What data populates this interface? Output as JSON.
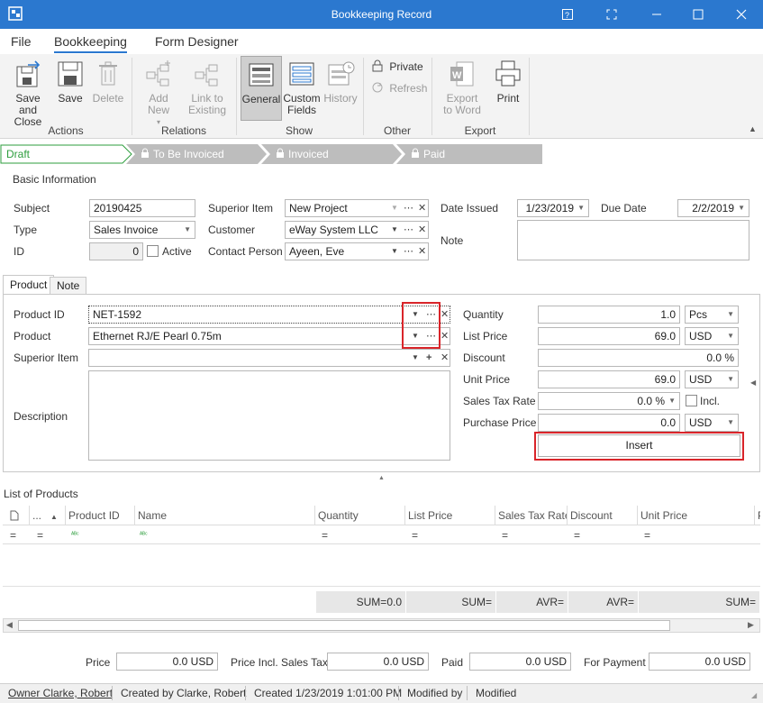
{
  "window": {
    "title": "Bookkeeping Record"
  },
  "menu": {
    "file": "File",
    "bookkeeping": "Bookkeeping",
    "form_designer": "Form Designer"
  },
  "ribbon": {
    "save_close": "Save and Close",
    "save_close_l1": "Save and",
    "save_close_l2": "Close",
    "save": "Save",
    "delete": "Delete",
    "add_new": "Add New",
    "link_l1": "Link to",
    "link_l2": "Existing",
    "general": "General",
    "custom_l1": "Custom",
    "custom_l2": "Fields",
    "history": "History",
    "private": "Private",
    "refresh": "Refresh",
    "export_l1": "Export",
    "export_l2": "to Word",
    "print": "Print",
    "groups": {
      "actions": "Actions",
      "relations": "Relations",
      "show": "Show",
      "other": "Other",
      "export": "Export"
    }
  },
  "workflow": {
    "steps": [
      "Draft",
      "To Be Invoiced",
      "Invoiced",
      "Paid"
    ],
    "active_color": "#2e9e3e"
  },
  "basic": {
    "section": "Basic Information",
    "subject_label": "Subject",
    "subject": "20190425",
    "type_label": "Type",
    "type": "Sales Invoice",
    "id_label": "ID",
    "id": "0",
    "active_label": "Active",
    "superior_label": "Superior Item",
    "superior": "New Project",
    "customer_label": "Customer",
    "customer": "eWay System LLC",
    "contact_label": "Contact Person",
    "contact": "Ayeen, Eve",
    "date_issued_label": "Date Issued",
    "date_issued": "1/23/2019",
    "due_label": "Due Date",
    "due": "2/2/2019",
    "note_label": "Note"
  },
  "tabs": {
    "product": "Product",
    "note": "Note"
  },
  "product": {
    "pid_label": "Product ID",
    "pid": "NET-1592",
    "product_label": "Product",
    "product": "Ethernet RJ/E Pearl 0.75m",
    "superior_label": "Superior Item",
    "desc_label": "Description",
    "qty_label": "Quantity",
    "qty": "1.0",
    "qty_unit": "Pcs",
    "list_label": "List Price",
    "list": "69.0",
    "list_cur": "USD",
    "disc_label": "Discount",
    "disc": "0.0 %",
    "unit_label": "Unit Price",
    "unit": "69.0",
    "unit_cur": "USD",
    "tax_label": "Sales Tax Rate",
    "tax": "0.0 %",
    "incl_label": "Incl.",
    "purchase_label": "Purchase Price",
    "purchase": "0.0",
    "purchase_cur": "USD",
    "insert": "Insert"
  },
  "list": {
    "title": "List of Products",
    "columns": [
      "...",
      "Product ID",
      "Name",
      "Quantity",
      "List Price",
      "Sales Tax Rate",
      "Discount",
      "Unit Price",
      "P"
    ],
    "sums": [
      "SUM=0.0",
      "SUM=",
      "AVR=",
      "AVR=",
      "SUM="
    ]
  },
  "totals": {
    "price_label": "Price",
    "price": "0.0 USD",
    "incl_label": "Price Incl. Sales Tax",
    "incl": "0.0 USD",
    "paid_label": "Paid",
    "paid": "0.0 USD",
    "payment_label": "For Payment",
    "payment": "0.0 USD"
  },
  "status": {
    "owner": "Owner Clarke, Robert",
    "created_by": "Created by Clarke, Robert",
    "created": "Created 1/23/2019 1:01:00 PM",
    "modified_by": "Modified by",
    "modified": "Modified"
  },
  "colors": {
    "accent": "#2b78cf",
    "highlight": "#d9252a"
  }
}
